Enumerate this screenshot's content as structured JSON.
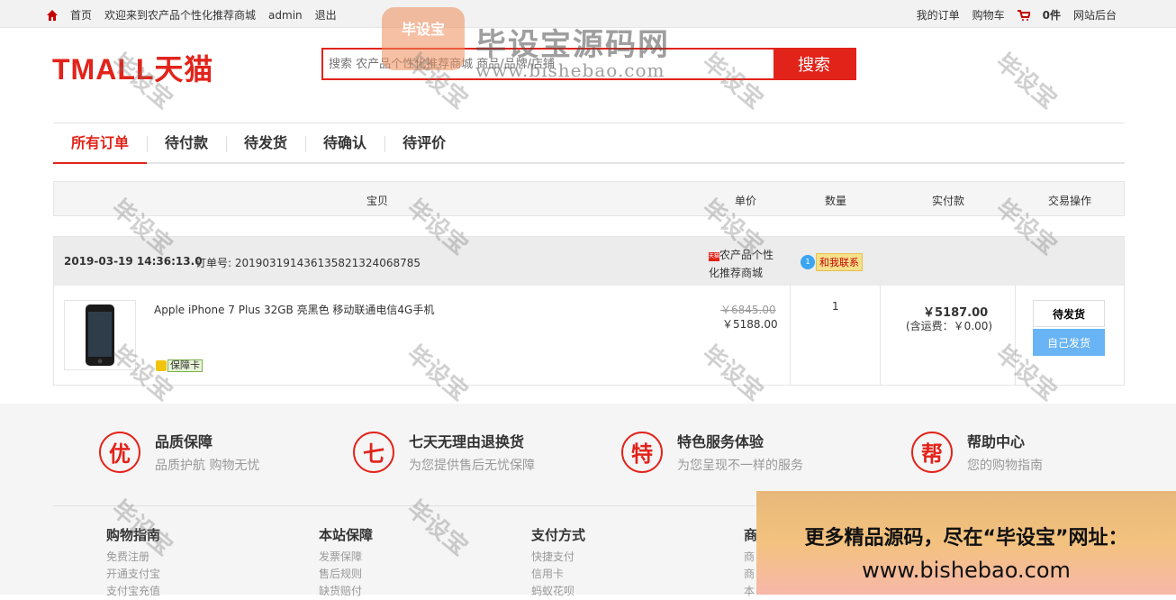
{
  "topbar": {
    "home": "首页",
    "welcome": "欢迎来到农产品个性化推荐商城",
    "user": "admin",
    "logout": "退出",
    "my_orders": "我的订单",
    "cart": "购物车",
    "cart_count": "0件",
    "admin": "网站后台"
  },
  "header": {
    "logo": "TMALL天猫",
    "search_placeholder": "搜索 农产品个性化推荐商城 商品/品牌/店铺",
    "search_button": "搜索"
  },
  "tabs": [
    "所有订单",
    "待付款",
    "待发货",
    "待确认",
    "待评价"
  ],
  "table_headers": {
    "item": "宝贝",
    "unit_price": "单价",
    "quantity": "数量",
    "paid": "实付款",
    "action": "交易操作"
  },
  "order": {
    "date": "2019-03-19 14:36:13.0",
    "order_no_label": "订单号: 20190319143613582132406878​5",
    "store_badge": "天猫",
    "store": "农产品个性化推荐商城",
    "contact_label": "和我联系",
    "product_title": "Apple iPhone 7 Plus 32GB 亮黑色 移动联通电信4G手机",
    "warranty": "保障卡",
    "price_old": "￥6845.00",
    "price_now": "￥5188.00",
    "quantity": "1",
    "paid": "￥5187.00",
    "shipping": "(含运费：￥0.00)",
    "status_button": "待发货",
    "ship_button": "自己发货"
  },
  "services": [
    {
      "icon": "优",
      "title": "品质保障",
      "sub": "品质护航  购物无忧"
    },
    {
      "icon": "七",
      "title": "七天无理由退换货",
      "sub": "为您提供售后无忧保障"
    },
    {
      "icon": "特",
      "title": "特色服务体验",
      "sub": "为您呈现不一样的服务"
    },
    {
      "icon": "帮",
      "title": "帮助中心",
      "sub": "您的购物指南"
    }
  ],
  "footer_cols": [
    {
      "title": "购物指南",
      "items": [
        "免费注册",
        "开通支付宝",
        "支付宝充值"
      ]
    },
    {
      "title": "本站保障",
      "items": [
        "发票保障",
        "售后规则",
        "缺货赔付"
      ]
    },
    {
      "title": "支付方式",
      "items": [
        "快捷支付",
        "信用卡",
        "蚂蚁花呗"
      ]
    },
    {
      "title": "商",
      "items": [
        "商",
        "商",
        "本"
      ]
    }
  ],
  "watermark": {
    "text": "毕设宝",
    "logo": "毕设宝",
    "title": "毕设宝源码网",
    "url": "www.bishebao.com",
    "banner_line1": "更多精品源码，尽在“毕设宝”网址：",
    "banner_line2": "www.bishebao.com"
  }
}
